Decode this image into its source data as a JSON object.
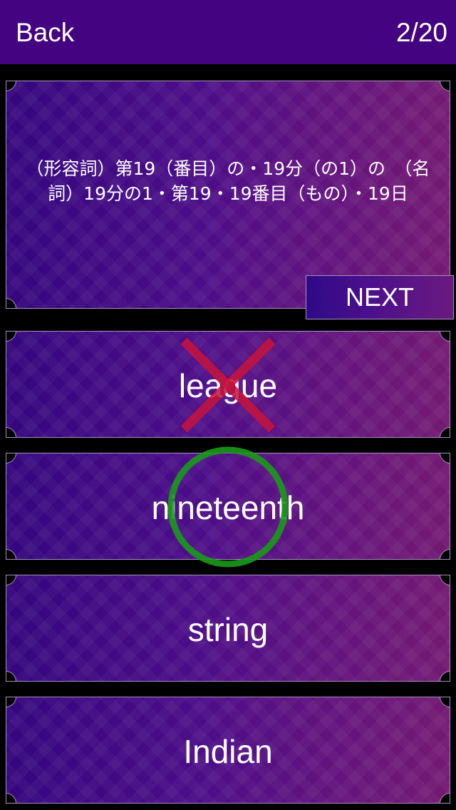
{
  "header": {
    "back_label": "Back",
    "progress": "2/20",
    "background_color": "#440482"
  },
  "question": {
    "text": "（形容詞）第19（番目）の・19分（の1）の　（名詞）19分の1・第19・19番目（もの）・19日"
  },
  "next_button": {
    "label": "NEXT"
  },
  "answers": [
    {
      "label": "league",
      "state": "wrong"
    },
    {
      "label": "nineteenth",
      "state": "correct"
    },
    {
      "label": "string",
      "state": "neutral"
    },
    {
      "label": "Indian",
      "state": "neutral"
    }
  ],
  "marks": {
    "wrong_icon": "cross-icon",
    "wrong_color": "#c8143c",
    "correct_icon": "circle-icon",
    "correct_color": "#1a9a1a"
  }
}
